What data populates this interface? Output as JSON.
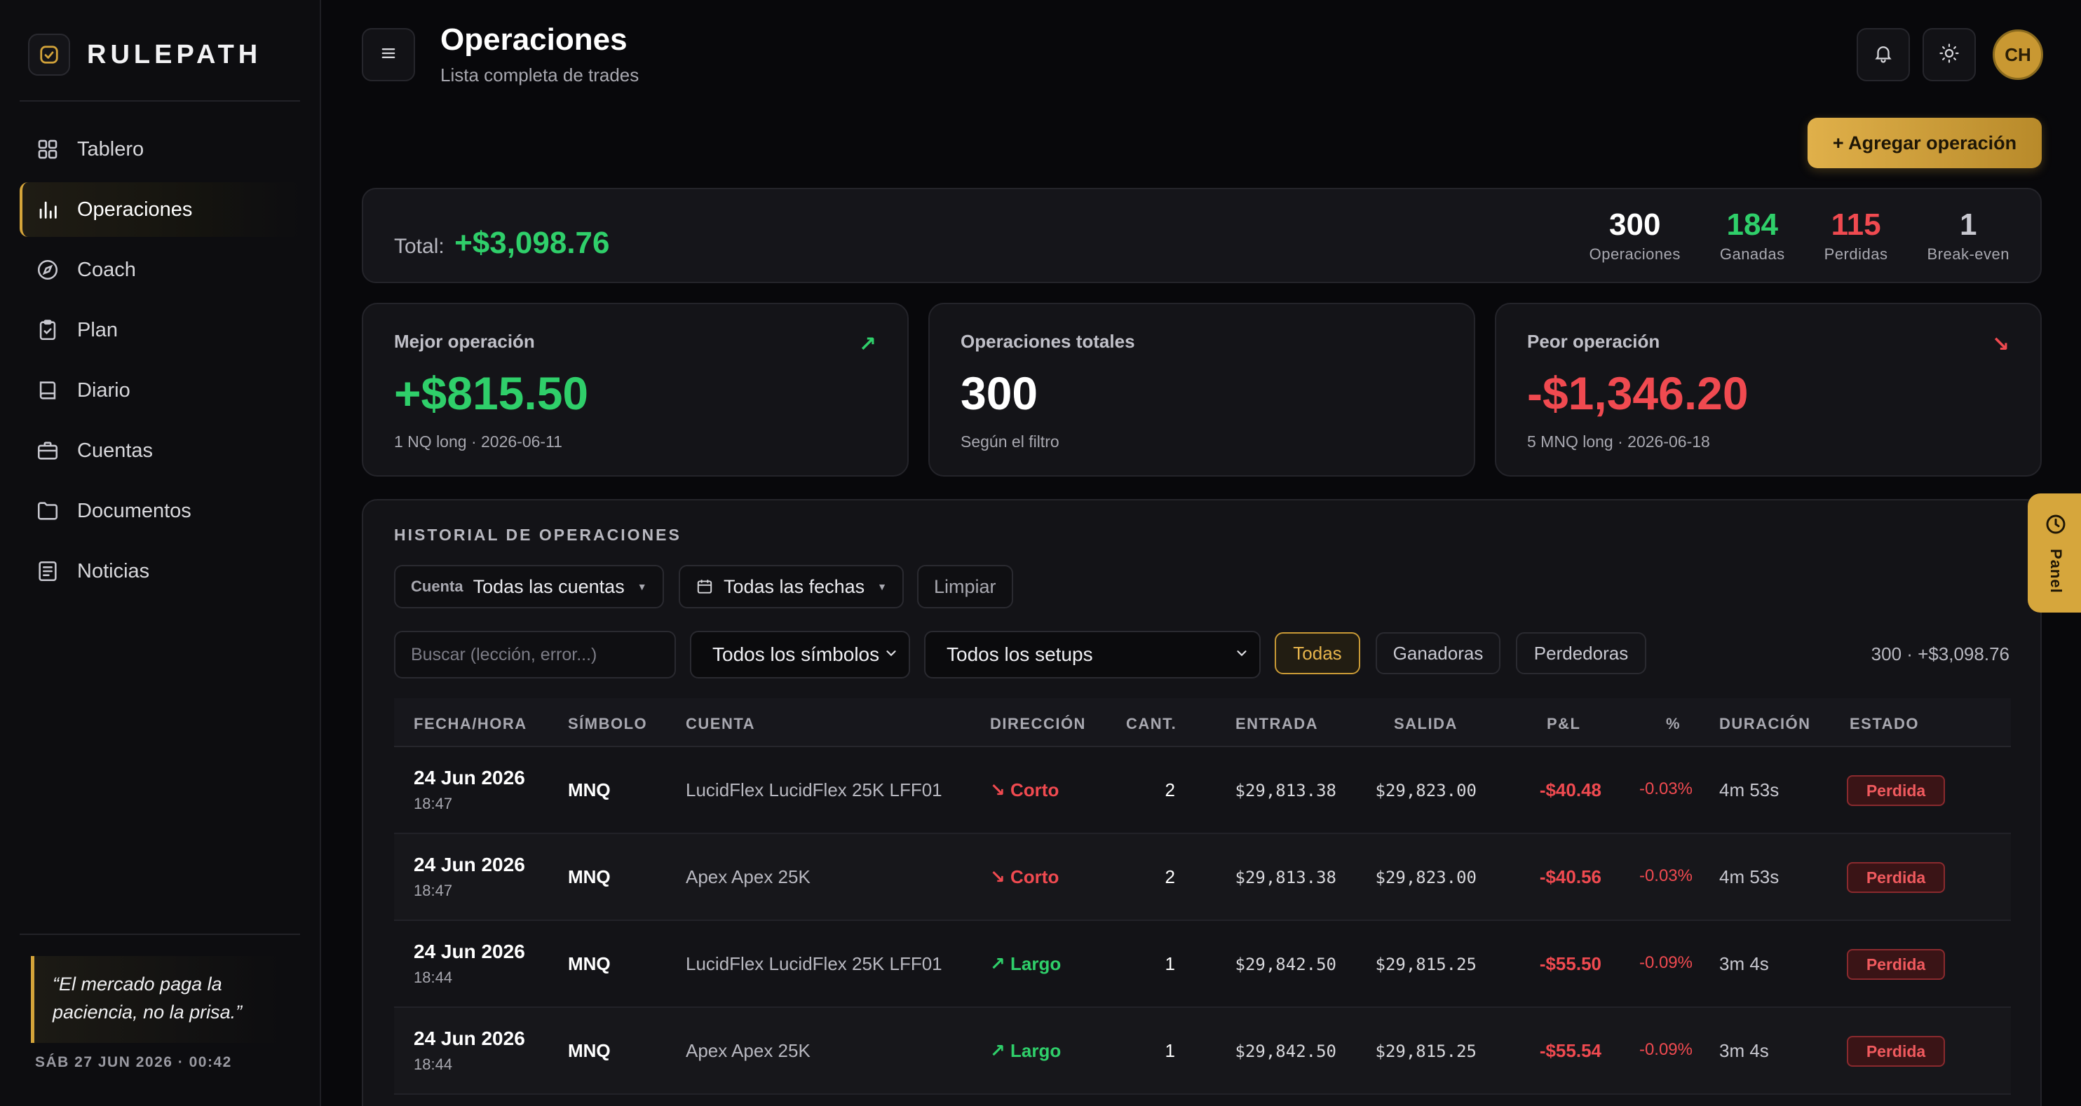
{
  "app": {
    "name": "RULEPATH"
  },
  "sidebar": {
    "items": [
      {
        "label": "Tablero",
        "icon": "grid-icon"
      },
      {
        "label": "Operaciones",
        "icon": "bar-chart-icon",
        "active": true
      },
      {
        "label": "Coach",
        "icon": "compass-icon"
      },
      {
        "label": "Plan",
        "icon": "clipboard-icon"
      },
      {
        "label": "Diario",
        "icon": "book-icon"
      },
      {
        "label": "Cuentas",
        "icon": "briefcase-icon"
      },
      {
        "label": "Documentos",
        "icon": "folder-icon"
      },
      {
        "label": "Noticias",
        "icon": "newspaper-icon"
      }
    ],
    "quote": "“El mercado paga la paciencia, no la prisa.”",
    "datetime": "SÁB 27 JUN 2026 · 00:42"
  },
  "header": {
    "title": "Operaciones",
    "subtitle": "Lista completa de trades",
    "avatar_initials": "CH",
    "add_label": "+ Agregar operación"
  },
  "totals": {
    "label": "Total:",
    "value": "+$3,098.76",
    "stats": [
      {
        "value": "300",
        "label": "Operaciones",
        "color": "#ffffff"
      },
      {
        "value": "184",
        "label": "Ganadas",
        "color": "#2fcf6a"
      },
      {
        "value": "115",
        "label": "Perdidas",
        "color": "#f04a50"
      },
      {
        "value": "1",
        "label": "Break-even",
        "color": "#c8c8d0"
      }
    ]
  },
  "cards": {
    "best": {
      "title": "Mejor operación",
      "value": "+$815.50",
      "sub": "1 NQ long · 2026-06-11",
      "arrow": "↗"
    },
    "total": {
      "title": "Operaciones totales",
      "value": "300",
      "sub": "Según el filtro"
    },
    "worst": {
      "title": "Peor operación",
      "value": "-$1,346.20",
      "sub": "5 MNQ long · 2026-06-18",
      "arrow": "↘"
    }
  },
  "history": {
    "title": "HISTORIAL DE OPERACIONES",
    "account_filter_label": "Cuenta",
    "account_filter_value": "Todas las cuentas",
    "date_filter": "Todas las fechas",
    "clear_label": "Limpiar",
    "search_placeholder": "Buscar (lección, error...)",
    "symbol_select": "Todos los símbolos",
    "setup_select": "Todos los setups",
    "result_filters": [
      "Todas",
      "Ganadoras",
      "Perdedoras"
    ],
    "summary": "300 · +$3,098.76",
    "columns": [
      "FECHA/HORA",
      "SÍMBOLO",
      "CUENTA",
      "DIRECCIÓN",
      "CANT.",
      "ENTRADA",
      "SALIDA",
      "P&L",
      "%",
      "DURACIÓN",
      "ESTADO"
    ],
    "rows": [
      {
        "date": "24 Jun 2026",
        "time": "18:47",
        "symbol": "MNQ",
        "account": "LucidFlex LucidFlex 25K LFF01",
        "direction": "↘ Corto",
        "qty": "2",
        "entry": "$29,813.38",
        "exit": "$29,823.00",
        "pnl": "-$40.48",
        "pct": "-0.03%",
        "duration": "4m 53s",
        "status": "Perdida"
      },
      {
        "date": "24 Jun 2026",
        "time": "18:47",
        "symbol": "MNQ",
        "account": "Apex Apex 25K",
        "direction": "↘ Corto",
        "qty": "2",
        "entry": "$29,813.38",
        "exit": "$29,823.00",
        "pnl": "-$40.56",
        "pct": "-0.03%",
        "duration": "4m 53s",
        "status": "Perdida"
      },
      {
        "date": "24 Jun 2026",
        "time": "18:44",
        "symbol": "MNQ",
        "account": "LucidFlex LucidFlex 25K LFF01",
        "direction": "↗ Largo",
        "qty": "1",
        "entry": "$29,842.50",
        "exit": "$29,815.25",
        "pnl": "-$55.50",
        "pct": "-0.09%",
        "duration": "3m 4s",
        "status": "Perdida"
      },
      {
        "date": "24 Jun 2026",
        "time": "18:44",
        "symbol": "MNQ",
        "account": "Apex Apex 25K",
        "direction": "↗ Largo",
        "qty": "1",
        "entry": "$29,842.50",
        "exit": "$29,815.25",
        "pnl": "-$55.54",
        "pct": "-0.09%",
        "duration": "3m 4s",
        "status": "Perdida"
      }
    ]
  },
  "panel_tab": {
    "label": "Panel"
  },
  "colors": {
    "accent": "#d4a43a",
    "positive": "#2fcf6a",
    "negative": "#f04a50",
    "background": "#08080b"
  }
}
